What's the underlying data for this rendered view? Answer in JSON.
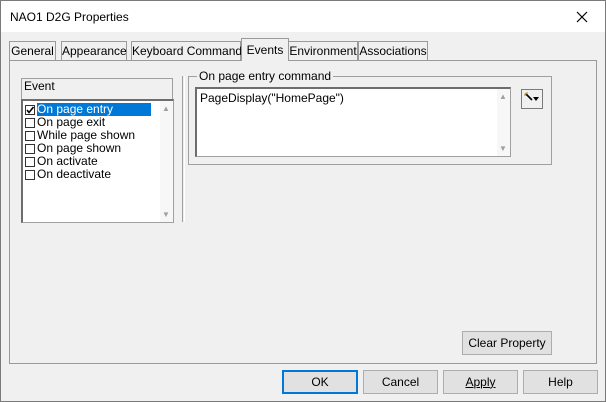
{
  "window": {
    "title": "NAO1 D2G Properties"
  },
  "tabs": [
    {
      "label": "General"
    },
    {
      "label": "Appearance"
    },
    {
      "label": "Keyboard Commands"
    },
    {
      "label": "Events"
    },
    {
      "label": "Environment"
    },
    {
      "label": "Associations"
    }
  ],
  "active_tab": "Events",
  "events_panel": {
    "header": "Event",
    "items": [
      {
        "label": "On page entry",
        "checked": true,
        "selected": true
      },
      {
        "label": "On page exit",
        "checked": false,
        "selected": false
      },
      {
        "label": "While page shown",
        "checked": false,
        "selected": false
      },
      {
        "label": "On page shown",
        "checked": false,
        "selected": false
      },
      {
        "label": "On activate",
        "checked": false,
        "selected": false
      },
      {
        "label": "On deactivate",
        "checked": false,
        "selected": false
      }
    ]
  },
  "command": {
    "group_label": "On page entry command",
    "value": "PageDisplay(\"HomePage\")"
  },
  "buttons": {
    "clear_property": "Clear Property",
    "ok": "OK",
    "cancel": "Cancel",
    "apply": "Apply",
    "help": "Help"
  },
  "colors": {
    "selection": "#0078d7",
    "default_button_border": "#0078d7"
  },
  "icons": {
    "close": "close-icon",
    "wand": "magic-wand-icon",
    "checkmark": "checkmark-icon"
  }
}
